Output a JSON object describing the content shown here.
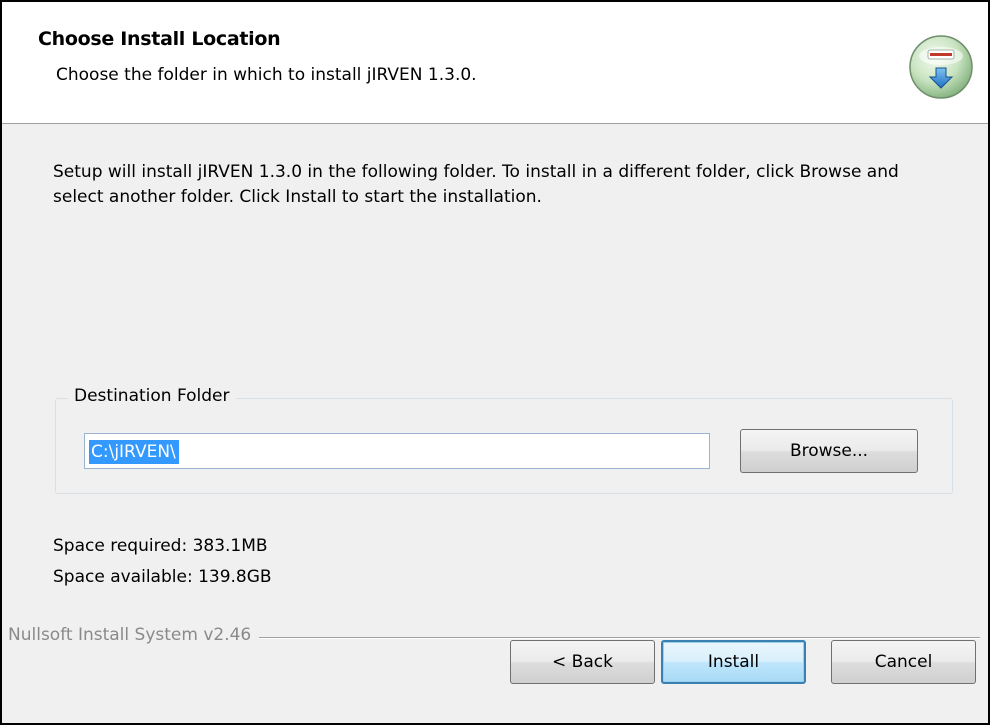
{
  "header": {
    "title": "Choose Install Location",
    "subtitle": "Choose the folder in which to install jIRVEN 1.3.0.",
    "icon": "nsis-installer-icon"
  },
  "body": {
    "intro": "Setup will install jIRVEN 1.3.0 in the following folder. To install in a different folder, click Browse and select another folder. Click Install to start the installation."
  },
  "destination": {
    "group_label": "Destination Folder",
    "path_value": "C:\\jIRVEN\\",
    "browse_label": "Browse..."
  },
  "space": {
    "required": "Space required: 383.1MB",
    "available": "Space available: 139.8GB"
  },
  "footer": {
    "branding": "Nullsoft Install System v2.46",
    "back_label": "< Back",
    "install_label": "Install",
    "cancel_label": "Cancel"
  },
  "colors": {
    "selection": "#3399ff",
    "dialog_bg": "#f0f0f0",
    "default_button_border": "#3c7fb1"
  }
}
